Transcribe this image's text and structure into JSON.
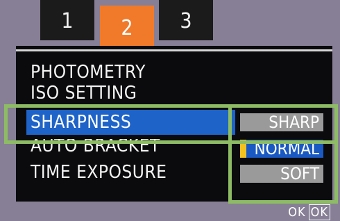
{
  "tabs": [
    {
      "label": "1"
    },
    {
      "label": "2"
    },
    {
      "label": "3"
    }
  ],
  "menu": {
    "items": [
      {
        "label": "PHOTOMETRY"
      },
      {
        "label": "ISO SETTING"
      },
      {
        "label": "SHARPNESS"
      },
      {
        "label": "AUTO BRACKET"
      },
      {
        "label": "TIME EXPOSURE"
      }
    ],
    "selected": "SHARPNESS"
  },
  "options": {
    "items": [
      {
        "label": "SHARP"
      },
      {
        "label": "NORMAL"
      },
      {
        "label": "SOFT"
      }
    ],
    "selected": "NORMAL"
  },
  "ok": {
    "hint": "OK",
    "key": "OK"
  },
  "colors": {
    "active_tab": "#f07a2a",
    "selection": "#1e63c8",
    "highlight_frame": "#8ebc64"
  }
}
